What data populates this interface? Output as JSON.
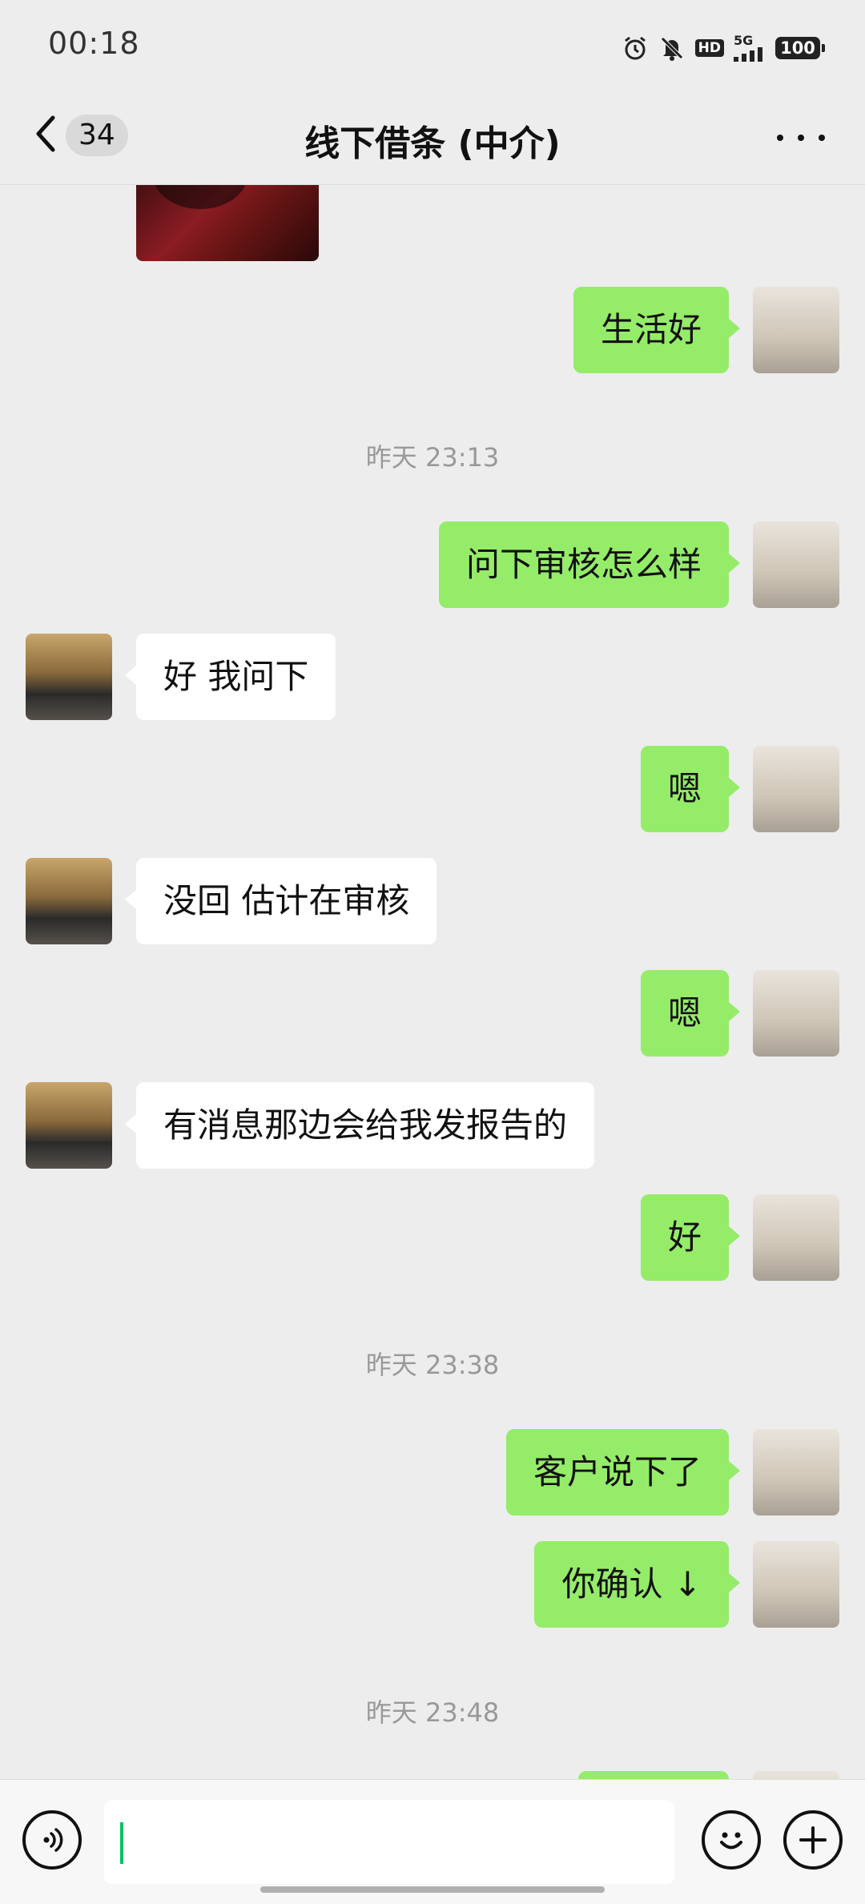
{
  "status_bar": {
    "time": "00:18",
    "network": "5G",
    "hd": "HD",
    "battery": "100",
    "icons": [
      "alarm-icon",
      "mute-icon",
      "hd-icon",
      "signal-icon",
      "battery-icon"
    ]
  },
  "header": {
    "back_icon": "chevron-left-icon",
    "unread_count": "34",
    "title": "线下借条 (中介)",
    "more_icon": "more-dots-icon"
  },
  "messages": {
    "m1": "生活好",
    "ts1": "昨天 23:13",
    "m2": "问下审核怎么样",
    "m3": "好 我问下",
    "m4": "嗯",
    "m5": "没回 估计在审核",
    "m6": "嗯",
    "m7": "有消息那边会给我发报告的",
    "m8": "好",
    "ts2": "昨天 23:38",
    "m9": "客户说下了",
    "m10": "你确认 ↓",
    "ts3": "昨天 23:48"
  },
  "input_bar": {
    "voice_icon": "voice-icon",
    "emoji_icon": "emoji-icon",
    "add_icon": "add-icon",
    "input_value": ""
  },
  "colors": {
    "background": "#ededed",
    "my_bubble": "#95ec69",
    "other_bubble": "#ffffff",
    "cursor": "#07c160"
  }
}
